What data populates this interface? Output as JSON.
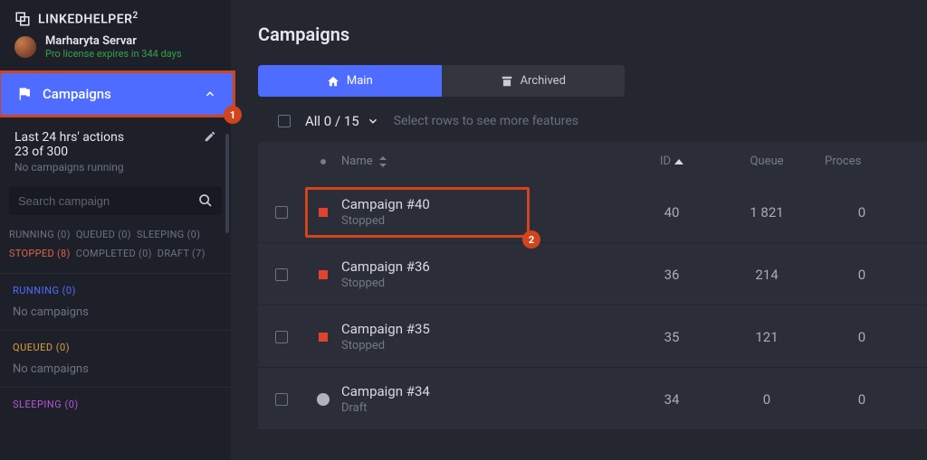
{
  "brand": {
    "name": "LINKEDHELPER",
    "sup": "2"
  },
  "user": {
    "name": "Marharyta Servar",
    "license": "Pro license expires in 344 days"
  },
  "nav": {
    "campaigns_label": "Campaigns"
  },
  "stats": {
    "title": "Last 24 hrs' actions",
    "counts": "23 of 300",
    "note": "No campaigns running"
  },
  "search": {
    "placeholder": "Search campaign"
  },
  "filters": {
    "running": "RUNNING (0)",
    "queued": "QUEUED (0)",
    "sleeping": "SLEEPING (0)",
    "stopped": "STOPPED (8)",
    "completed": "COMPLETED (0)",
    "draft": "DRAFT (7)"
  },
  "side_sections": {
    "running": {
      "label": "RUNNING (0)",
      "empty": "No campaigns"
    },
    "queued": {
      "label": "QUEUED (0)",
      "empty": "No campaigns"
    },
    "sleeping": {
      "label": "SLEEPING (0)"
    }
  },
  "page": {
    "title": "Campaigns"
  },
  "tabs": {
    "main": "Main",
    "archived": "Archived"
  },
  "selector": {
    "all": "All 0 / 15",
    "hint": "Select rows to see more features"
  },
  "columns": {
    "name": "Name",
    "id": "ID",
    "queue": "Queue",
    "processed": "Proces"
  },
  "rows": [
    {
      "name": "Campaign #40",
      "status_text": "Stopped",
      "status": "stopped",
      "id": "40",
      "queue": "1 821",
      "processed": "0"
    },
    {
      "name": "Campaign #36",
      "status_text": "Stopped",
      "status": "stopped",
      "id": "36",
      "queue": "214",
      "processed": "0"
    },
    {
      "name": "Campaign #35",
      "status_text": "Stopped",
      "status": "stopped",
      "id": "35",
      "queue": "121",
      "processed": "0"
    },
    {
      "name": "Campaign #34",
      "status_text": "Draft",
      "status": "draft",
      "id": "34",
      "queue": "0",
      "processed": "0"
    }
  ],
  "annotations": {
    "one": "1",
    "two": "2"
  }
}
